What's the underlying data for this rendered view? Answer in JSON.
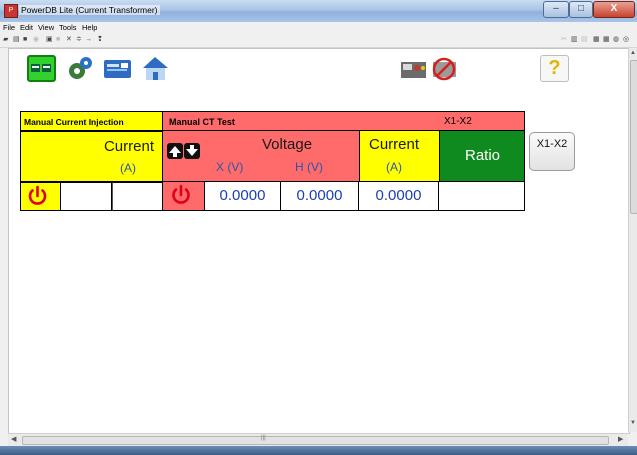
{
  "window": {
    "title": "PowerDB Lite (Current Transformer)",
    "buttons": {
      "minimize": "–",
      "maximize": "□",
      "close": "X"
    }
  },
  "menu": [
    "File",
    "Edit",
    "View",
    "Tools",
    "Help"
  ],
  "toolbar": {
    "left_icons": [
      "new-icon",
      "open-icon",
      "save-icon",
      "print-icon",
      "record-icon",
      "form-icon",
      "delete-icon",
      "insert-icon",
      "arrow-icon",
      "help-icon"
    ],
    "right_icons": [
      "cut-icon",
      "copy-icon",
      "paste-icon",
      "view-icon",
      "grid-icon",
      "preview-icon",
      "print-preview-icon"
    ]
  },
  "big_toolbar": {
    "icons": [
      "instrument-connect-icon",
      "settings-icon",
      "card-icon",
      "home-icon",
      "test-set-icon",
      "no-test-icon",
      "help-question-icon"
    ],
    "help_label": "?"
  },
  "manual_injection": {
    "header": "Manual Current Injection",
    "current_label": "Current",
    "current_unit": "(A)",
    "power_icon": "power-icon",
    "input_value": ""
  },
  "manual_ct": {
    "header": "Manual CT Test",
    "tap": "X1-X2",
    "voltage_label": "Voltage",
    "x_unit": "X (V)",
    "h_unit": "H (V)",
    "current_label": "Current",
    "current_unit": "(A)",
    "ratio_label": "Ratio",
    "x_value": "0.0000",
    "h_value": "0.0000",
    "current_value": "0.0000",
    "ratio_value": "",
    "tap_button": "X1-X2"
  },
  "colors": {
    "yellow": "#ffff00",
    "red": "#ff6a6a",
    "green": "#0f8a1f",
    "value_blue": "#1a3fb3"
  }
}
